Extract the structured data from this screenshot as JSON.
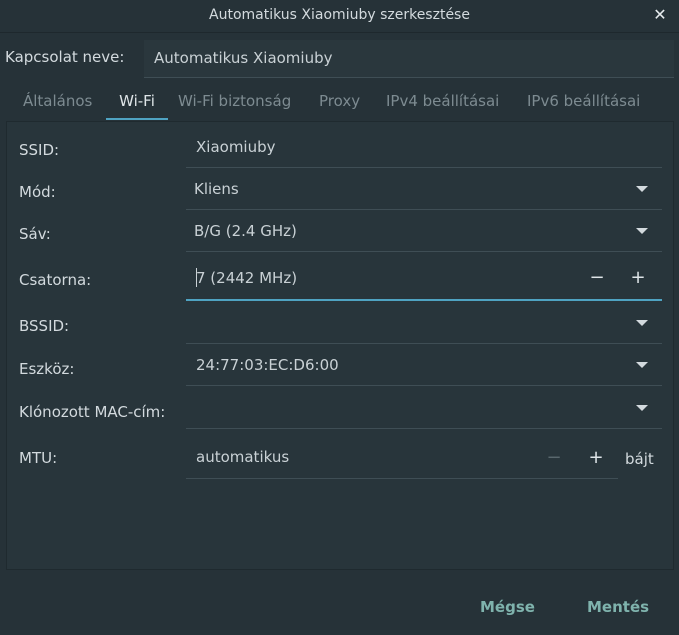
{
  "window": {
    "title": "Automatikus Xiaomiuby szerkesztése"
  },
  "connection": {
    "label": "Kapcsolat neve:",
    "value": "Automatikus Xiaomiuby"
  },
  "tabs": [
    {
      "label": "Általános"
    },
    {
      "label": "Wi-Fi"
    },
    {
      "label": "Wi-Fi biztonság"
    },
    {
      "label": "Proxy"
    },
    {
      "label": "IPv4 beállításai"
    },
    {
      "label": "IPv6 beállításai"
    }
  ],
  "form": {
    "ssid": {
      "label": "SSID:",
      "value": "Xiaomiuby"
    },
    "mode": {
      "label": "Mód:",
      "value": "Kliens"
    },
    "band": {
      "label": "Sáv:",
      "value": "B/G (2.4 GHz)"
    },
    "channel": {
      "label": "Csatorna:",
      "value": "7 (2442 MHz)",
      "minus": "−",
      "plus": "+"
    },
    "bssid": {
      "label": "BSSID:",
      "value": ""
    },
    "device": {
      "label": "Eszköz:",
      "value": "24:77:03:EC:D6:00"
    },
    "cloned_mac": {
      "label": "Klónozott MAC-cím:",
      "value": ""
    },
    "mtu": {
      "label": "MTU:",
      "value": "automatikus",
      "minus": "−",
      "plus": "+",
      "unit": "bájt"
    }
  },
  "footer": {
    "cancel": "Mégse",
    "save": "Mentés"
  },
  "colors": {
    "background": "#263238",
    "accent": "#4fa3c2",
    "button_text": "#7fb3ad"
  }
}
